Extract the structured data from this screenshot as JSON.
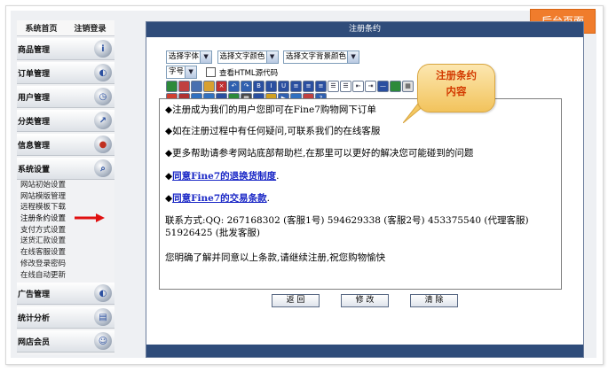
{
  "corner_tag": "后台页面",
  "sidebar": {
    "top_home": "系统首页",
    "top_logout": "注销登录",
    "categories": [
      {
        "label": "商品管理",
        "icon": "info-icon"
      },
      {
        "label": "订单管理",
        "icon": "globe-icon"
      },
      {
        "label": "用户管理",
        "icon": "clock-icon"
      },
      {
        "label": "分类管理",
        "icon": "arrow-icon"
      },
      {
        "label": "信息管理",
        "icon": "palette-icon"
      },
      {
        "label": "系统设置",
        "icon": "search-icon"
      }
    ],
    "system_items": [
      "网站初始设置",
      "网站模版管理",
      "远程模板下载",
      "注册条约设置",
      "支付方式设置",
      "送货汇款设置",
      "在线客服设置",
      "修改登录密码",
      "在线自动更新"
    ],
    "lower_categories": [
      {
        "label": "广告管理",
        "icon": "globe-icon"
      },
      {
        "label": "统计分析",
        "icon": "chart-icon"
      },
      {
        "label": "网店会员",
        "icon": "users-icon"
      }
    ]
  },
  "panel": {
    "title": "注册条约",
    "font_select": "选择字体",
    "color_select": "选择文字颜色",
    "bgcolor_select": "选择文字背景颜色",
    "size_select": "字号",
    "html_toggle": "查看HTML源代码",
    "content": {
      "line1": "◆注册成为我们的用户您即可在Fine7购物网下订单",
      "line2": "◆如在注册过程中有任何疑问,可联系我们的在线客服",
      "line3": "◆更多帮助请参考网站底部帮助栏,在那里可以更好的解决您可能碰到的问题",
      "line4_prefix": "◆",
      "line4_link": "同意Fine7的退换货制度",
      "line4_suffix": ".",
      "line5_prefix": "◆",
      "line5_link": "同意Fine7的交易条款",
      "line5_suffix": ".",
      "contact": "联系方式:QQ: 267168302 (客服1号) 594629338 (客服2号) 453375540 (代理客服) 51926425 (批发客服)",
      "closing": "您明确了解并同意以上条款,请继续注册,祝您购物愉快"
    },
    "buttons": {
      "back": "返 回",
      "modify": "修 改",
      "clear": "清 除"
    }
  },
  "callout": {
    "line1": "注册条约",
    "line2": "内容"
  }
}
